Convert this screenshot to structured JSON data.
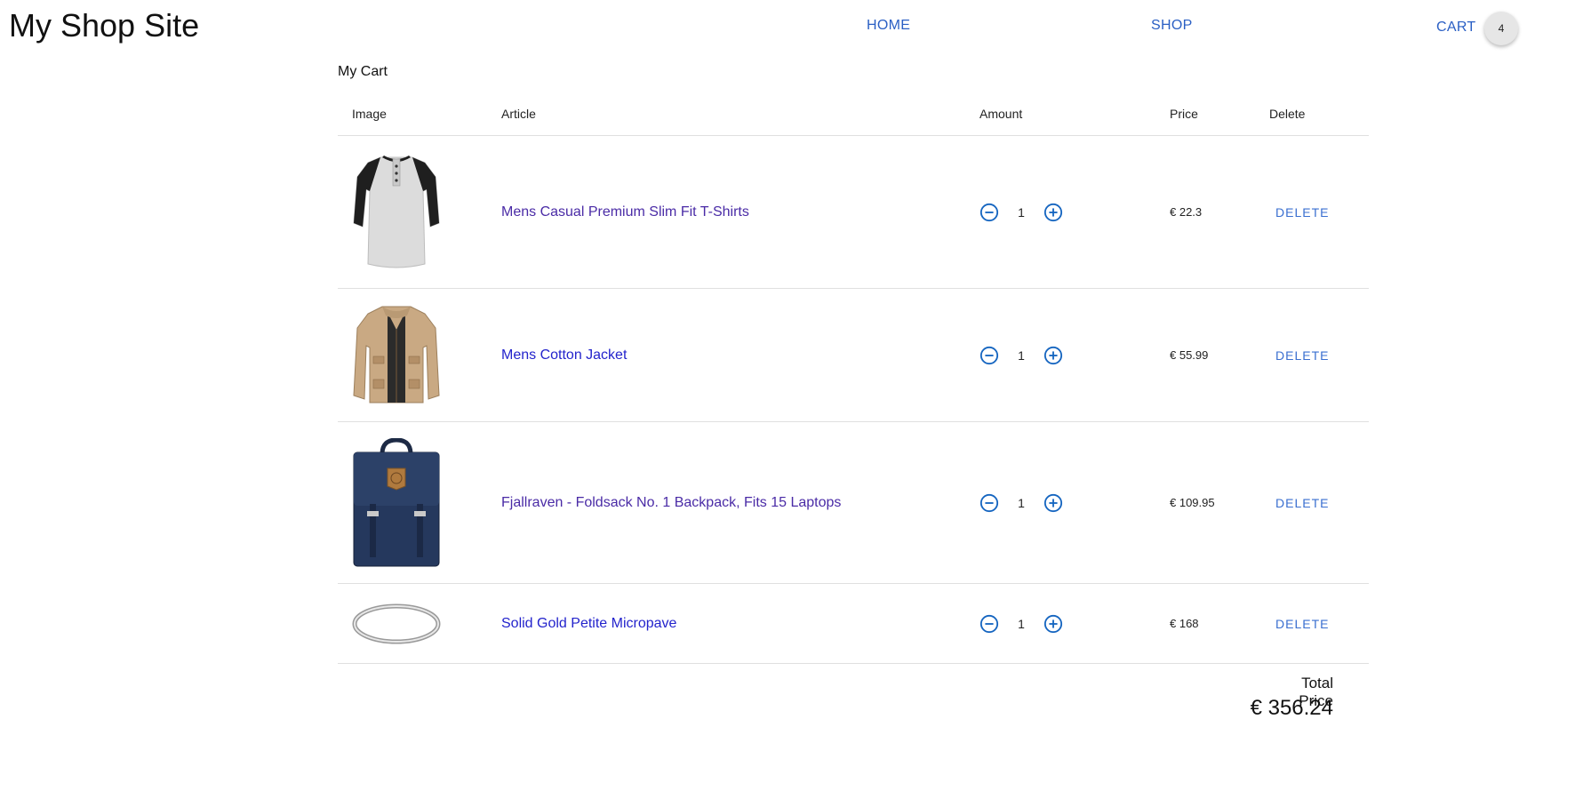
{
  "header": {
    "site_title": "My Shop Site",
    "nav": {
      "home": "HOME",
      "shop": "SHOP",
      "cart": "CART"
    },
    "cart_count": "4"
  },
  "cart": {
    "title": "My Cart",
    "columns": {
      "image": "Image",
      "article": "Article",
      "amount": "Amount",
      "price": "Price",
      "delete": "Delete"
    },
    "items": [
      {
        "name": "Mens Casual Premium Slim Fit T-Shirts",
        "quantity": "1",
        "price": "€ 22.3",
        "delete_label": "DELETE",
        "image": "tshirt-image",
        "link_visited": true
      },
      {
        "name": "Mens Cotton Jacket",
        "quantity": "1",
        "price": "€ 55.99",
        "delete_label": "DELETE",
        "image": "jacket-image",
        "link_visited": false
      },
      {
        "name": "Fjallraven - Foldsack No. 1 Backpack, Fits 15 Laptops",
        "quantity": "1",
        "price": "€ 109.95",
        "delete_label": "DELETE",
        "image": "backpack-image",
        "link_visited": true
      },
      {
        "name": "Solid Gold Petite Micropave",
        "quantity": "1",
        "price": "€ 168",
        "delete_label": "DELETE",
        "image": "ring-image",
        "link_visited": false
      }
    ],
    "total_label": "Total Price",
    "total_value": "€ 356.24"
  },
  "colors": {
    "link": "#2a5fc4",
    "visited_link": "#4a2ba6",
    "unvisited_link": "#2323cc",
    "icon": "#1565c0"
  }
}
